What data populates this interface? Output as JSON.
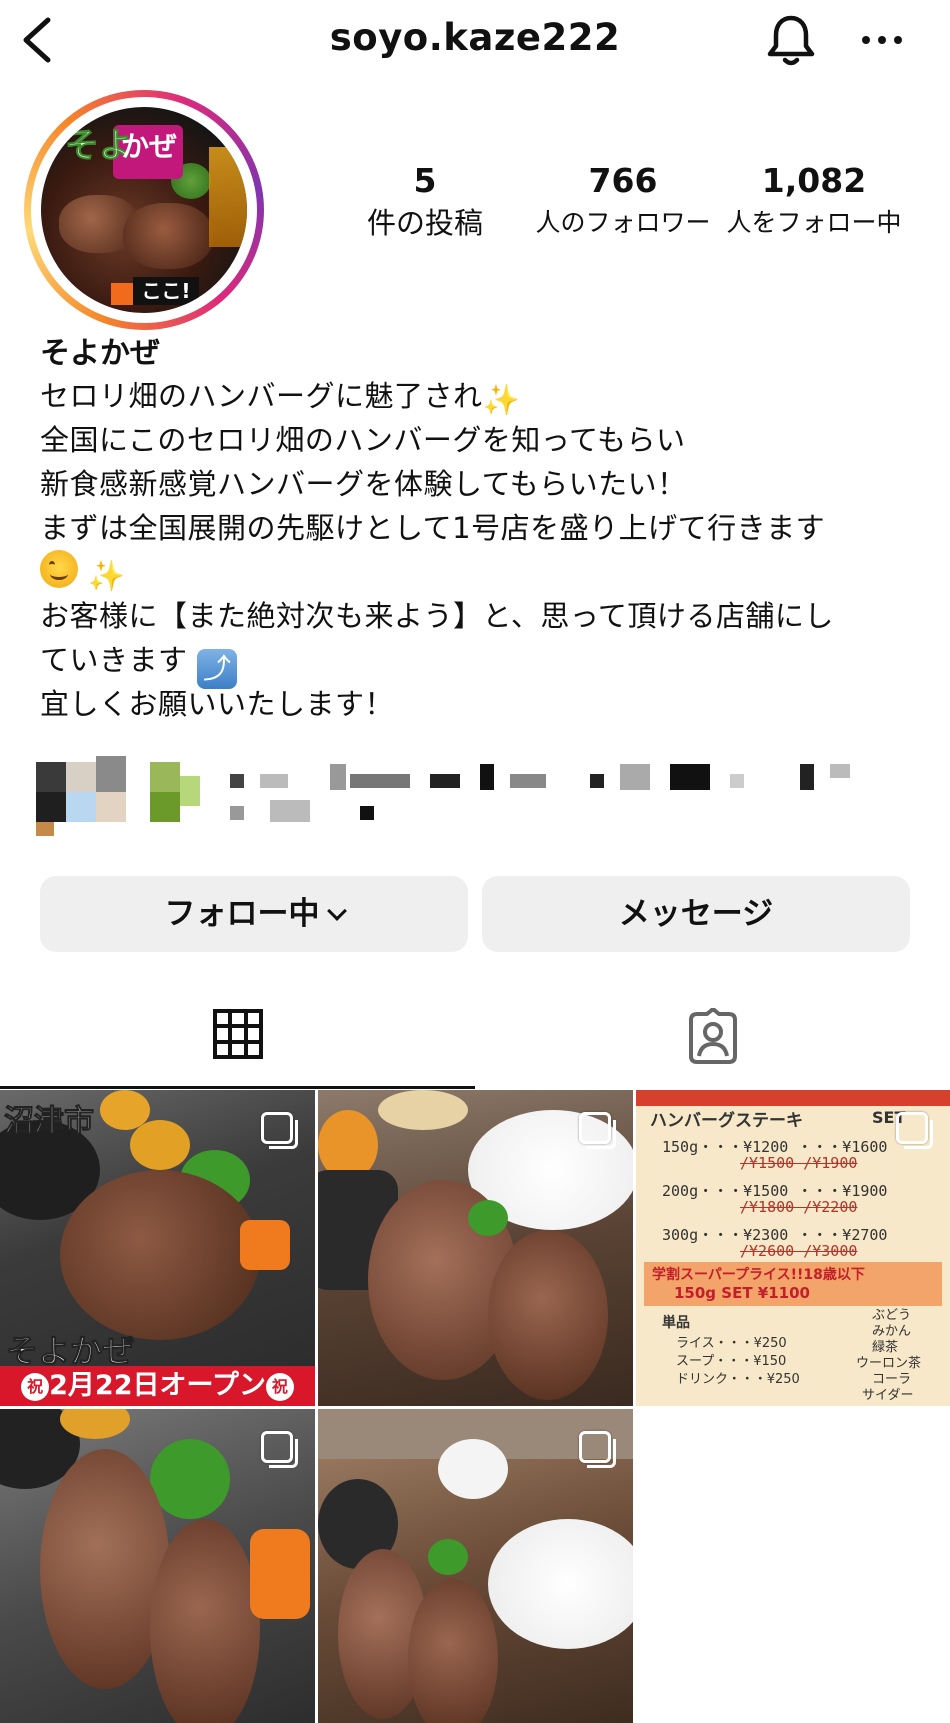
{
  "header": {
    "username": "soyo.kaze222",
    "back_icon": "chevron-left-icon",
    "notification_icon": "bell-icon",
    "more_icon": "more-horizontal-icon"
  },
  "profile": {
    "avatar_text": "ここ!",
    "avatar_logo_1": "そよ",
    "avatar_logo_2": "かぜ",
    "stats": {
      "posts": {
        "value": "5",
        "label": "件の投稿"
      },
      "followers": {
        "value": "766",
        "label": "人のフォロワー"
      },
      "following": {
        "value": "1,082",
        "label": "人をフォロー中"
      }
    },
    "display_name": "そよかぜ",
    "bio": [
      "セロリ畑のハンバーグに魅了され",
      "全国にこのセロリ畑のハンバーグを知ってもらい",
      "新食感新感覚ハンバーグを体験してもらいたい！",
      "まずは全国展開の先駆けとして1号店を盛り上げて行きます",
      "",
      "お客様に【また絶対次も来よう】と、思って頂ける店舗にし",
      "ていきます",
      "宜しくお願いいたします！"
    ],
    "bio_emoji": {
      "sparkle": "✨",
      "arrow": "⤴"
    }
  },
  "actions": {
    "follow_label": "フォロー中",
    "message_label": "メッセージ"
  },
  "tabs": [
    {
      "name": "grid",
      "icon": "grid-icon",
      "active": true
    },
    {
      "name": "tagged",
      "icon": "tagged-person-icon",
      "active": false
    }
  ],
  "posts": {
    "p1": {
      "city": "沼津市",
      "shop": "そよかぜ",
      "opening": "2月22日オープン",
      "iwai": "祝"
    },
    "p3": {
      "title": "ハンバーグステーキ",
      "set_label": "SET",
      "rows": [
        "150g・・・¥1200 ・・・¥1600",
        "/¥1500    /¥1900",
        "200g・・・¥1500 ・・・¥1900",
        "/¥1800    /¥2200",
        "300g・・・¥2300 ・・・¥2700",
        "/¥2600    /¥3000"
      ],
      "student_title": "学割スーパープライス!!18歳以下",
      "student_row": "150g  SET    ¥1100",
      "single_title": "単品",
      "single_rows": [
        "ライス・・・¥250",
        "スープ・・・¥150",
        "ドリンク・・・¥250"
      ],
      "drinks": [
        "ぶどう",
        "みかん",
        "緑茶",
        "ウーロン茶",
        "コーラ",
        "サイダー"
      ]
    }
  },
  "colors": {
    "button_bg": "#efefef",
    "text": "#111111",
    "accent_red": "#d8182a"
  }
}
